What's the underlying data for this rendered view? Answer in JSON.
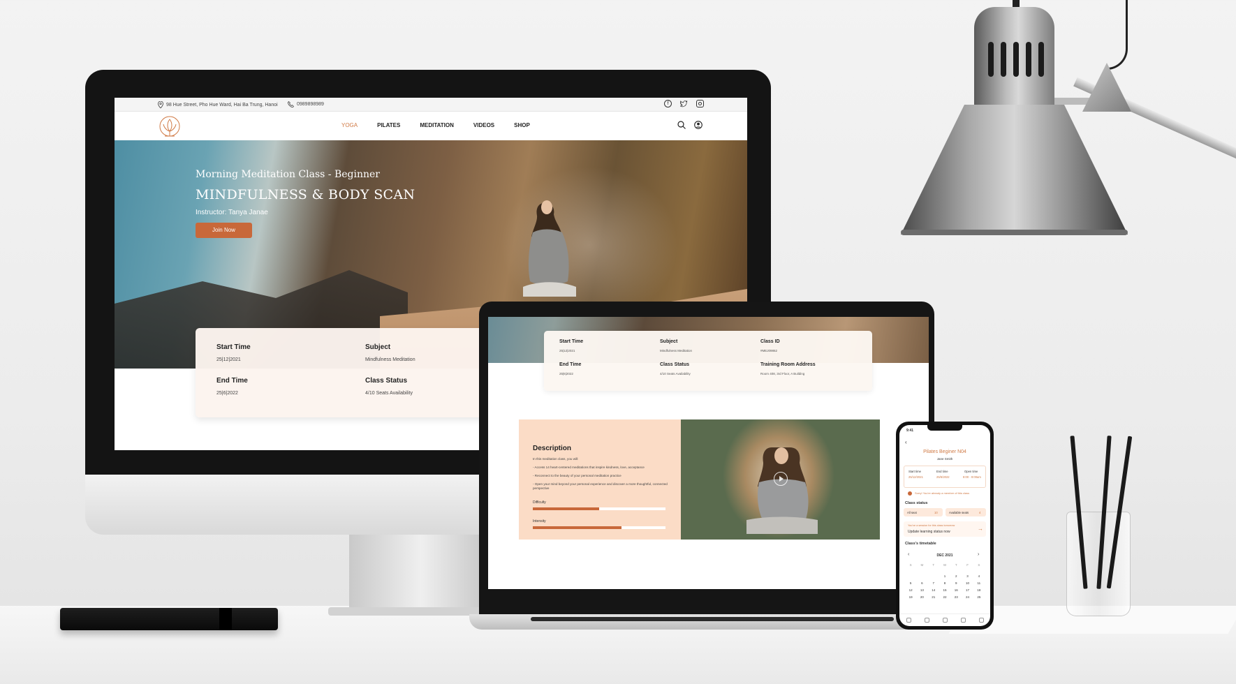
{
  "imac": {
    "topbar": {
      "address": "98 Hue Street, Pho Hue Ward, Hai Ba Trung, Hanoi",
      "phone": "0989898989",
      "social_icons": [
        "facebook-icon",
        "twitter-icon",
        "instagram-icon"
      ]
    },
    "nav": {
      "items": [
        "YOGA",
        "PILATES",
        "MEDITATION",
        "VIDEOS",
        "SHOP"
      ],
      "active_item": "YOGA"
    },
    "hero": {
      "subtitle": "Morning Meditation Class - Beginner",
      "title": "MINDFULNESS & BODY SCAN",
      "instructor": "Instructor: Tanya Janae",
      "button": "Join Now"
    },
    "info": {
      "start_label": "Start Time",
      "start_value": "25|12|2021",
      "subject_label": "Subject",
      "subject_value": "Mindfulness Meditation",
      "end_label": "End Time",
      "end_value": "25|6|2022",
      "status_label": "Class Status",
      "status_value": "4/10 Seats Availability"
    }
  },
  "laptop": {
    "info": {
      "start_label": "Start Time",
      "start_value": "25|12|2021",
      "subject_label": "Subject",
      "subject_value": "Mindfulness Meditation",
      "classid_label": "Class ID",
      "classid_value": "#MEJ09862",
      "end_label": "End Time",
      "end_value": "25|6|2022",
      "status_label": "Class Status",
      "status_value": "4/10 Seats Availability",
      "room_label": "Training Room Address",
      "room_value": "Room 408, 3rd Floor, A Building"
    },
    "description": {
      "heading": "Description",
      "intro": "In this meditation class, you will:",
      "b1": "- Access 14 heart-centered meditations that inspire kindness, love, acceptance",
      "b2": "- Reconnect to the beauty of your personal meditation practice",
      "b3": "- Open your mind beyond your personal experience and discover a more thoughtful, connected perspective",
      "difficulty_label": "Difficulty",
      "difficulty": 0.5,
      "intensity_label": "Intensity",
      "intensity": 0.67
    }
  },
  "phone": {
    "status_time": "9:41",
    "title": "Pilates Beginer N04",
    "teacher": "Jane Smith",
    "start_label": "Start time",
    "start_value": "25/12/2021",
    "end_label": "End time",
    "end_value": "25/6/2022",
    "open_label": "Open time",
    "open_value": "8:00 - 9:00am",
    "notice": "Sorry! You're already a member of this class",
    "status_heading": "Class status",
    "all_seat_label": "All seat",
    "all_seat_value": "10",
    "avail_label": "Available seats",
    "avail_value": "4",
    "reminder_small": "You've a session for this class tomorrow",
    "reminder": "Update learning status now",
    "timetable_heading": "Class's timetable",
    "month": "DEC 2021",
    "weekdays": [
      "S",
      "M",
      "T",
      "W",
      "T",
      "F",
      "S"
    ],
    "days": [
      "",
      "",
      "",
      "1",
      "2",
      "3",
      "4",
      "5",
      "6",
      "7",
      "8",
      "9",
      "10",
      "11",
      "12",
      "13",
      "14",
      "15",
      "16",
      "17",
      "18",
      "19",
      "20",
      "21",
      "22",
      "23",
      "24",
      "25"
    ]
  },
  "colors": {
    "accent": "#c8683a",
    "accent_light": "#fbdcc6",
    "accent_text": "#d07a45"
  }
}
